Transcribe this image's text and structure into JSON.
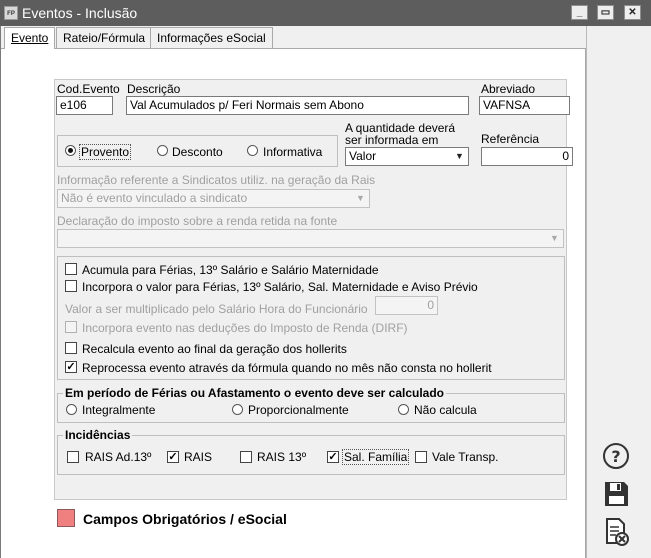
{
  "window": {
    "app_icon": "FP",
    "title": "Eventos - Inclusão",
    "minimize": "_",
    "maximize": "▭",
    "close": "✕"
  },
  "tabs": [
    {
      "label": "Evento",
      "active": true
    },
    {
      "label": "Rateio/Fórmula",
      "active": false
    },
    {
      "label": "Informações eSocial",
      "active": false
    }
  ],
  "form": {
    "cod_evento": {
      "label": "Cod.Evento",
      "value": "e106"
    },
    "descricao": {
      "label": "Descrição",
      "value": "Val Acumulados p/ Feri Normais sem Abono"
    },
    "abreviado": {
      "label": "Abreviado",
      "value": "VAFNSA"
    },
    "tipo": {
      "options": [
        "Provento",
        "Desconto",
        "Informativa"
      ],
      "selected": "Provento"
    },
    "quantidade": {
      "label_line1": "A quantidade deverá",
      "label_line2": "ser informada em",
      "value": "Valor"
    },
    "referencia": {
      "label": "Referência",
      "value": "0"
    },
    "sindicato": {
      "label": "Informação referente a Sindicatos utiliz. na geração da Rais",
      "value": "Não é evento vinculado a sindicato"
    },
    "declaracao": {
      "label": "Declaração do imposto sobre a renda retida na fonte",
      "value": ""
    },
    "options": {
      "acumula": {
        "label": "Acumula para Férias, 13º Salário e Salário Maternidade",
        "checked": false
      },
      "incorpora": {
        "label": "Incorpora o valor para Férias, 13º Salário, Sal. Maternidade e Aviso Prévio",
        "checked": false
      },
      "multiplicar_label": "Valor a ser multiplicado pelo Salário Hora do Funcionário",
      "multiplicar_value": "0",
      "dirf": {
        "label": "Incorpora evento nas deduções do Imposto de Renda (DIRF)",
        "checked": false
      },
      "recalcula": {
        "label": "Recalcula evento ao final da geração dos hollerits",
        "checked": false
      },
      "reprocessa": {
        "label": "Reprocessa evento através da fórmula quando no mês não consta no hollerit",
        "checked": true
      }
    },
    "periodo": {
      "title": "Em período de Férias ou Afastamento o evento deve ser calculado",
      "options": [
        "Integralmente",
        "Proporcionalmente",
        "Não calcula"
      ]
    },
    "incidencias": {
      "title": "Incidências",
      "items": [
        {
          "label": "RAIS Ad.13º",
          "checked": false
        },
        {
          "label": "RAIS",
          "checked": true
        },
        {
          "label": "RAIS 13º",
          "checked": false
        },
        {
          "label": "Sal. Família",
          "checked": true
        },
        {
          "label": "Vale Transp.",
          "checked": false
        }
      ]
    }
  },
  "legend": {
    "label": "Campos Obrigatórios / eSocial",
    "color": "#f08080"
  },
  "side_icons": [
    "help-icon",
    "save-icon",
    "cancel-document-icon"
  ],
  "check_mark": "✓",
  "combo_arrow": "▼"
}
